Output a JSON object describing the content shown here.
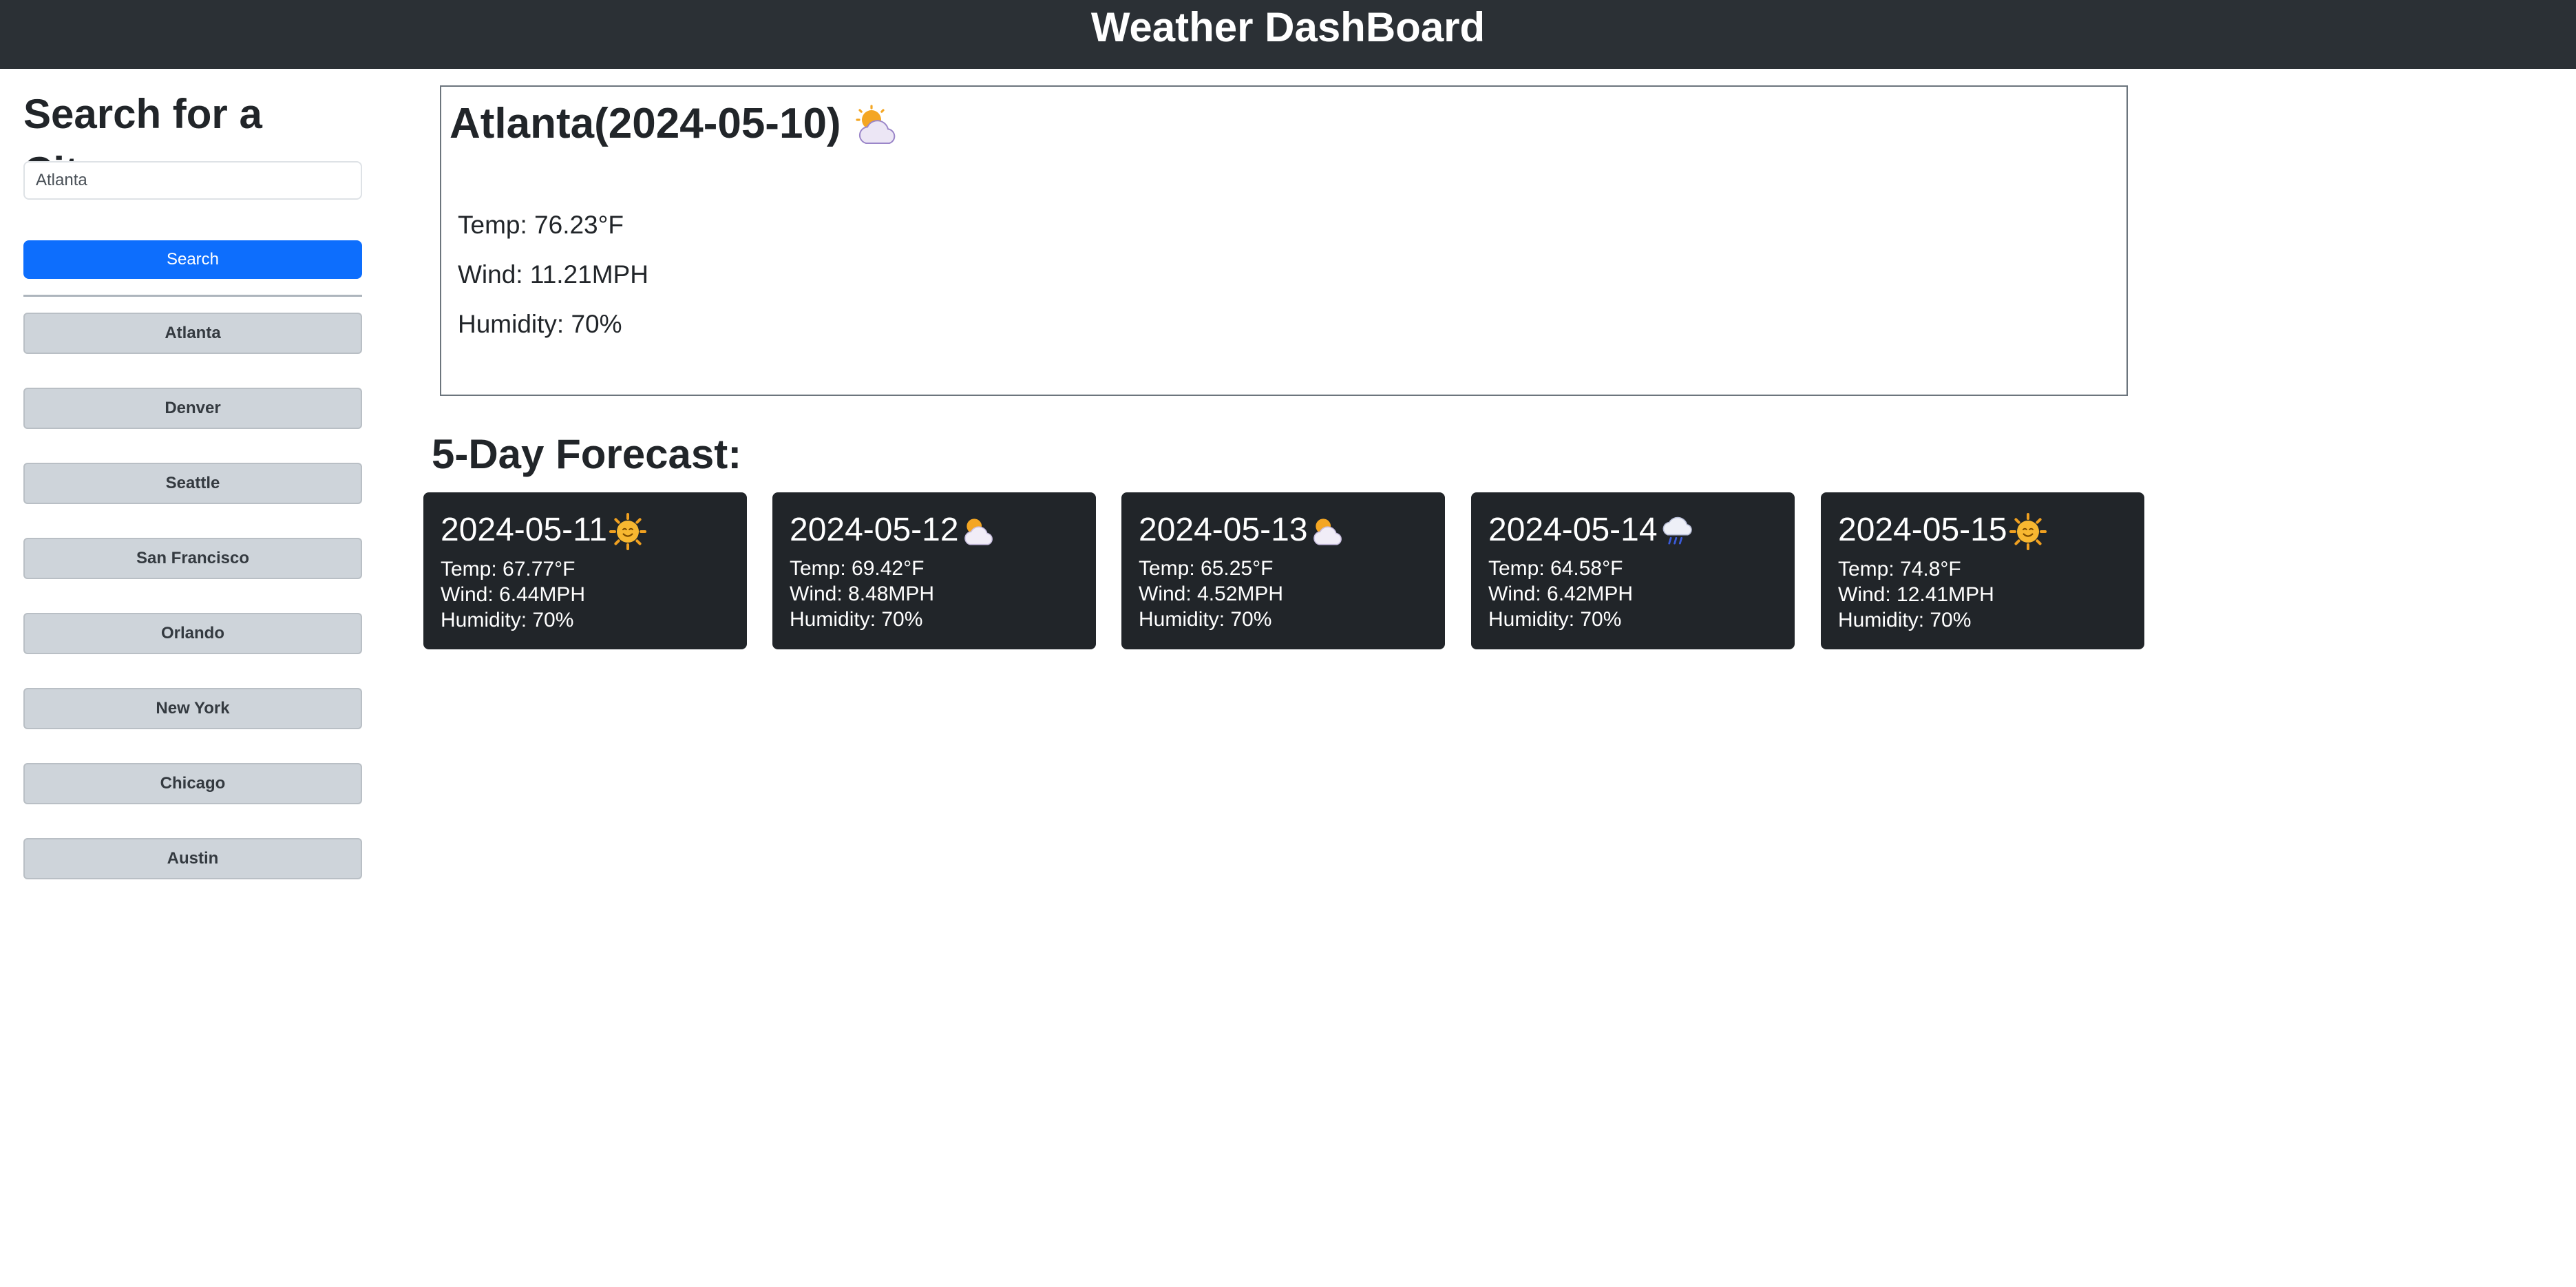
{
  "header": {
    "title": "Weather DashBoard"
  },
  "sidebar": {
    "heading": "Search for a City:",
    "search": {
      "value": "Atlanta",
      "button_label": "Search"
    },
    "history": [
      "Atlanta",
      "Denver",
      "Seattle",
      "San Francisco",
      "Orlando",
      "New York",
      "Chicago",
      "Austin"
    ]
  },
  "current": {
    "title": "Atlanta(2024-05-10)",
    "icon": "partly-cloudy-icon",
    "temp": "Temp: 76.23°F",
    "wind": "Wind: 11.21MPH",
    "humidity": "Humidity: 70%"
  },
  "forecast": {
    "heading": "5-Day Forecast:",
    "days": [
      {
        "date": "2024-05-11",
        "icon": "sun-icon",
        "temp": "Temp: 67.77°F",
        "wind": "Wind: 6.44MPH",
        "humidity": "Humidity: 70%"
      },
      {
        "date": "2024-05-12",
        "icon": "partly-cloudy-icon",
        "temp": "Temp: 69.42°F",
        "wind": "Wind: 8.48MPH",
        "humidity": "Humidity: 70%"
      },
      {
        "date": "2024-05-13",
        "icon": "partly-cloudy-icon",
        "temp": "Temp: 65.25°F",
        "wind": "Wind: 4.52MPH",
        "humidity": "Humidity: 70%"
      },
      {
        "date": "2024-05-14",
        "icon": "rain-icon",
        "temp": "Temp: 64.58°F",
        "wind": "Wind: 6.42MPH",
        "humidity": "Humidity: 70%"
      },
      {
        "date": "2024-05-15",
        "icon": "sun-icon",
        "temp": "Temp: 74.8°F",
        "wind": "Wind: 12.41MPH",
        "humidity": "Humidity: 70%"
      }
    ]
  },
  "colors": {
    "header_bg": "#2b3035",
    "primary": "#0d6efd",
    "history_btn": "#ced4da",
    "card_bg": "#212529"
  }
}
